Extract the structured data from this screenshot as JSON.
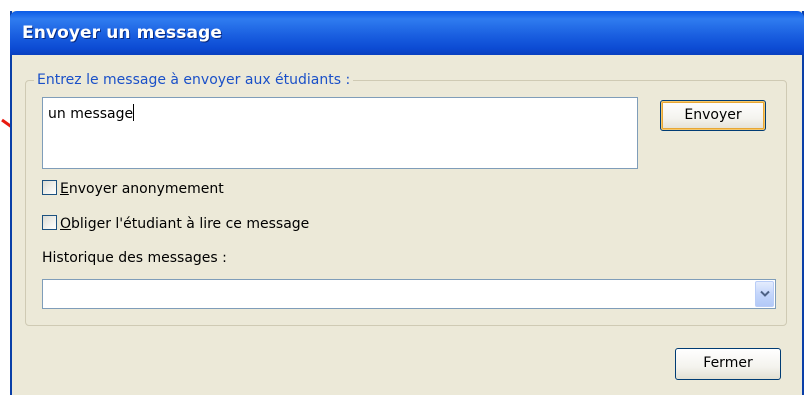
{
  "dialog": {
    "title": "Envoyer un message"
  },
  "message_group": {
    "legend": "Entrez le message à envoyer aux étudiants :",
    "message_value": "un message"
  },
  "buttons": {
    "send_label": "Envoyer",
    "close_label": "Fermer"
  },
  "options": {
    "anonymous": {
      "mnemonic": "E",
      "label_rest": "nvoyer anonymement",
      "checked": false
    },
    "force_read": {
      "mnemonic": "O",
      "label_rest": "bliger l'étudiant à lire ce message",
      "checked": false
    }
  },
  "history": {
    "label": "Historique des messages :",
    "selected_value": ""
  },
  "icons": {
    "annotation_arrow": "arrow-icon",
    "dropdown": "chevron-down-icon"
  },
  "colors": {
    "titlebar": "#0b5be6",
    "legend_text": "#1a50c8",
    "annotation_arrow": "#e8190f"
  }
}
